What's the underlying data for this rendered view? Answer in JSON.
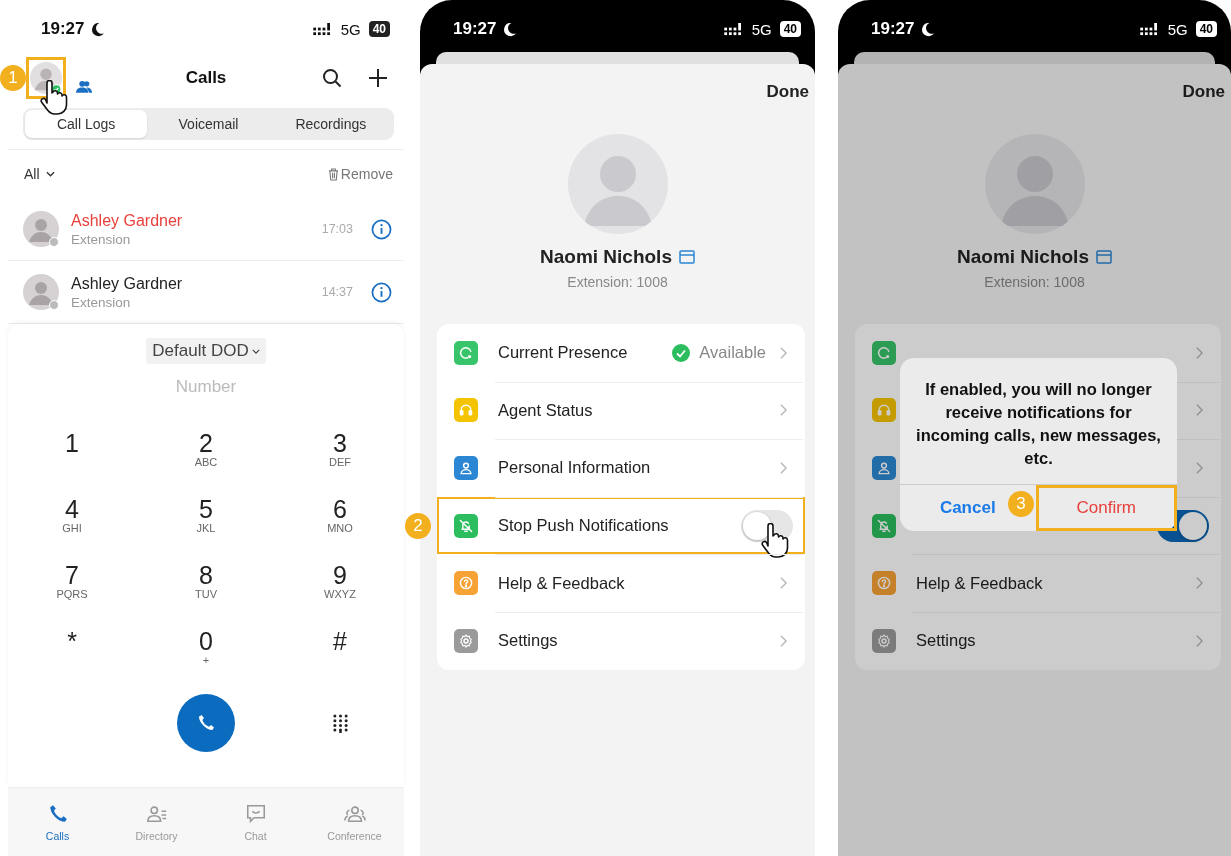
{
  "calls_screen": {
    "status": {
      "time": "19:27",
      "network": "5G",
      "battery": "40"
    },
    "avatar_highlighted": true,
    "step": "1",
    "title": "Calls",
    "tabs": [
      {
        "label": "Call Logs",
        "selected": true
      },
      {
        "label": "Voicemail",
        "selected": false
      },
      {
        "label": "Recordings",
        "selected": false
      }
    ],
    "filter": "All",
    "remove": "Remove",
    "calls": [
      {
        "name": "Ashley Gardner",
        "missed": true,
        "subtitle": "Extension",
        "time": "17:03"
      },
      {
        "name": "Ashley Gardner",
        "missed": false,
        "subtitle": "Extension",
        "time": "14:37"
      }
    ],
    "caller_id": "Default DOD",
    "number_placeholder": "Number",
    "keys": [
      {
        "digit": "1"
      },
      {
        "digit": "2",
        "letters": "ABC"
      },
      {
        "digit": "3",
        "letters": "DEF"
      },
      {
        "digit": "4",
        "letters": "GHI"
      },
      {
        "digit": "5",
        "letters": "JKL"
      },
      {
        "digit": "6",
        "letters": "MNO"
      },
      {
        "digit": "7",
        "letters": "PQRS"
      },
      {
        "digit": "8",
        "letters": "TUV"
      },
      {
        "digit": "9",
        "letters": "WXYZ"
      },
      {
        "digit": "*"
      },
      {
        "digit": "0",
        "letters": "+"
      },
      {
        "digit": "#"
      }
    ],
    "nav": [
      {
        "label": "Calls",
        "selected": true
      },
      {
        "label": "Directory",
        "selected": false
      },
      {
        "label": "Chat",
        "selected": false
      },
      {
        "label": "Conference",
        "selected": false
      }
    ]
  },
  "profile_screen": {
    "status": {
      "time": "19:27",
      "network": "5G",
      "battery": "40"
    },
    "done": "Done",
    "name": "Naomi Nichols",
    "extension": "Extension: 1008",
    "menu": [
      {
        "kind": "link",
        "label": "Current Presence",
        "value": "Available"
      },
      {
        "kind": "link",
        "label": "Agent Status"
      },
      {
        "kind": "link",
        "label": "Personal Information"
      },
      {
        "kind": "toggle",
        "label": "Stop Push Notifications",
        "on": false,
        "highlighted": true,
        "step": "2"
      },
      {
        "kind": "link",
        "label": "Help & Feedback"
      },
      {
        "kind": "link",
        "label": "Settings"
      }
    ]
  },
  "confirm_screen": {
    "status": {
      "time": "19:27",
      "network": "5G",
      "battery": "40"
    },
    "done": "Done",
    "name": "Naomi Nichols",
    "extension": "Extension: 1008",
    "menu": [
      {
        "kind": "link"
      },
      {
        "kind": "link"
      },
      {
        "kind": "link"
      },
      {
        "kind": "toggle",
        "on": true,
        "highlighted": false
      },
      {
        "kind": "link",
        "label": "Help & Feedback"
      },
      {
        "kind": "link",
        "label": "Settings"
      }
    ],
    "dialog": {
      "message": "If enabled, you will no longer receive notifications for incoming calls, new messages, etc.",
      "cancel": "Cancel",
      "confirm": "Confirm",
      "confirm_highlighted": true,
      "step": "3"
    }
  }
}
